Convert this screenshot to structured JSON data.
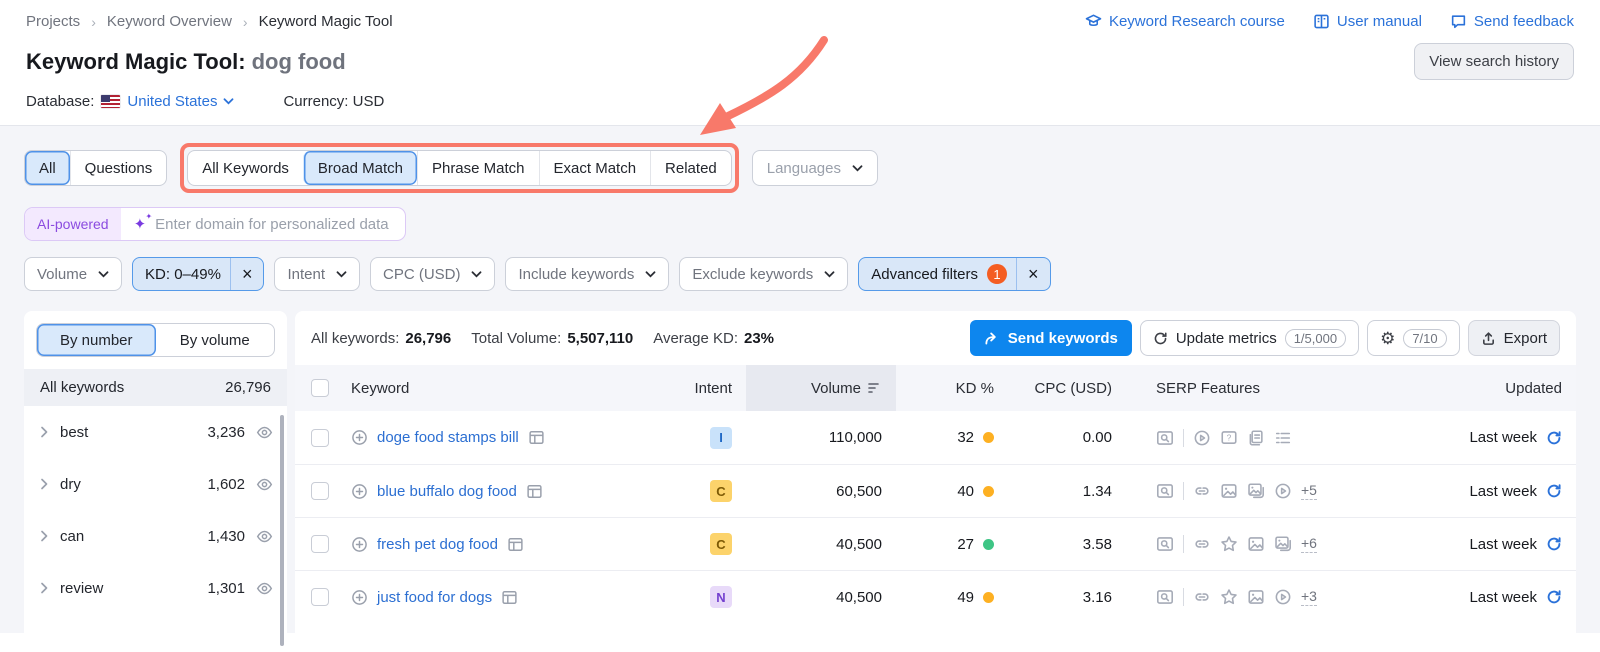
{
  "breadcrumb": {
    "items": [
      "Projects",
      "Keyword Overview",
      "Keyword Magic Tool"
    ],
    "separator": "›"
  },
  "header_links": {
    "course": "Keyword Research course",
    "manual": "User manual",
    "feedback": "Send feedback"
  },
  "title": {
    "prefix": "Keyword Magic Tool:",
    "query": "dog food"
  },
  "actions": {
    "view_search_history": "View search history"
  },
  "database_bar": {
    "database_label": "Database:",
    "database_value": "United States",
    "currency_label": "Currency:",
    "currency_value": "USD"
  },
  "match_tabs": {
    "all": "All",
    "questions": "Questions",
    "types": [
      "All Keywords",
      "Broad Match",
      "Phrase Match",
      "Exact Match",
      "Related"
    ],
    "selected_type": "Broad Match",
    "languages": "Languages"
  },
  "ai_bar": {
    "badge": "AI-powered",
    "placeholder": "Enter domain for personalized data"
  },
  "filters": {
    "volume": "Volume",
    "kd": "KD: 0–49%",
    "intent": "Intent",
    "cpc": "CPC (USD)",
    "include": "Include keywords",
    "exclude": "Exclude keywords",
    "advanced": "Advanced filters",
    "advanced_count": "1"
  },
  "sidebar": {
    "tab_by_number": "By number",
    "tab_by_volume": "By volume",
    "all_keywords_label": "All keywords",
    "all_keywords_count": "26,796",
    "groups": [
      {
        "label": "best",
        "count": "3,236"
      },
      {
        "label": "dry",
        "count": "1,602"
      },
      {
        "label": "can",
        "count": "1,430"
      },
      {
        "label": "review",
        "count": "1,301"
      }
    ]
  },
  "toolbar": {
    "stats": {
      "all_label": "All keywords:",
      "all_value": "26,796",
      "volume_label": "Total Volume:",
      "volume_value": "5,507,110",
      "kd_label": "Average KD:",
      "kd_value": "23%"
    },
    "send_keywords": "Send keywords",
    "update_metrics": "Update metrics",
    "update_quota": "1/5,000",
    "settings_quota": "7/10",
    "export": "Export"
  },
  "table": {
    "headers": {
      "keyword": "Keyword",
      "intent": "Intent",
      "volume": "Volume",
      "kd": "KD %",
      "cpc": "CPC (USD)",
      "serp": "SERP Features",
      "updated": "Updated"
    },
    "rows": [
      {
        "keyword": "doge food stamps bill",
        "intent": "I",
        "volume": "110,000",
        "kd": "32",
        "kd_level": "medium",
        "cpc": "0.00",
        "serp_icons": [
          "serp-preview-icon",
          "play-circle-icon",
          "question-chat-icon",
          "copy-pages-icon",
          "list-menu-icon"
        ],
        "serp_more": "",
        "updated": "Last week"
      },
      {
        "keyword": "blue buffalo dog food",
        "intent": "C",
        "volume": "60,500",
        "kd": "40",
        "kd_level": "medium",
        "cpc": "1.34",
        "serp_icons": [
          "serp-preview-icon",
          "link-icon",
          "image-icon",
          "image-copy-icon",
          "play-circle-icon"
        ],
        "serp_more": "+5",
        "updated": "Last week"
      },
      {
        "keyword": "fresh pet dog food",
        "intent": "C",
        "volume": "40,500",
        "kd": "27",
        "kd_level": "easy",
        "cpc": "3.58",
        "serp_icons": [
          "serp-preview-icon",
          "link-icon",
          "star-icon",
          "image-icon",
          "image-copy-icon"
        ],
        "serp_more": "+6",
        "updated": "Last week"
      },
      {
        "keyword": "just food for dogs",
        "intent": "N",
        "volume": "40,500",
        "kd": "49",
        "kd_level": "medium",
        "cpc": "3.16",
        "serp_icons": [
          "serp-preview-icon",
          "link-icon",
          "star-icon",
          "image-icon",
          "play-circle-icon"
        ],
        "serp_more": "+3",
        "updated": "Last week"
      }
    ]
  },
  "colors": {
    "accent_blue": "#0d86ee",
    "link_blue": "#2b72d9",
    "annotation_red": "#f8796a",
    "kd_medium": "#fdb022",
    "kd_easy": "#3ec585",
    "selected_bg": "#d9e9fb"
  }
}
